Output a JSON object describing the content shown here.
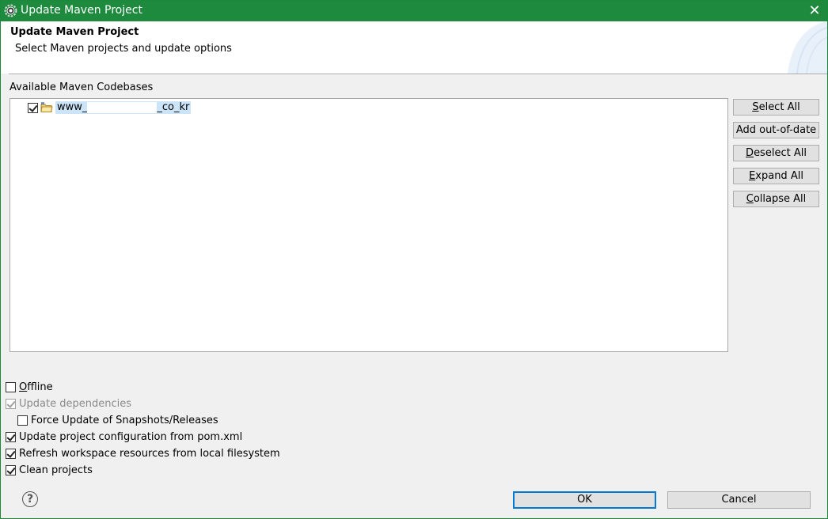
{
  "window": {
    "title": "Update Maven Project",
    "accent_color": "#1e8a3e"
  },
  "header": {
    "title": "Update Maven Project",
    "subtitle": "Select Maven projects and update options"
  },
  "codebases": {
    "label": "Available Maven Codebases",
    "items": [
      {
        "name_prefix": "www_",
        "name_suffix": "_co_kr",
        "checked": true,
        "icon": "maven-project-folder-icon"
      }
    ]
  },
  "side_buttons": {
    "select_all": {
      "mnemonic": "S",
      "rest": "elect All"
    },
    "add_out_of_date": {
      "label": "Add out-of-date"
    },
    "deselect_all": {
      "mnemonic": "D",
      "rest": "eselect All"
    },
    "expand_all": {
      "mnemonic": "E",
      "rest": "xpand All"
    },
    "collapse_all": {
      "mnemonic": "C",
      "rest": "ollapse All"
    }
  },
  "options": {
    "offline": {
      "mnemonic": "O",
      "rest": "ffline",
      "checked": false,
      "enabled": true
    },
    "update_dependencies": {
      "label": "Update dependencies",
      "checked": true,
      "enabled": false
    },
    "force_update": {
      "label": "Force Update of Snapshots/Releases",
      "checked": false,
      "enabled": true
    },
    "update_config": {
      "label": "Update project configuration from pom.xml",
      "checked": true,
      "enabled": true
    },
    "refresh_workspace": {
      "label": "Refresh workspace resources from local filesystem",
      "checked": true,
      "enabled": true
    },
    "clean_projects": {
      "label": "Clean projects",
      "checked": true,
      "enabled": true
    }
  },
  "footer": {
    "help_icon": "help-icon",
    "ok_label": "OK",
    "cancel_label": "Cancel"
  }
}
